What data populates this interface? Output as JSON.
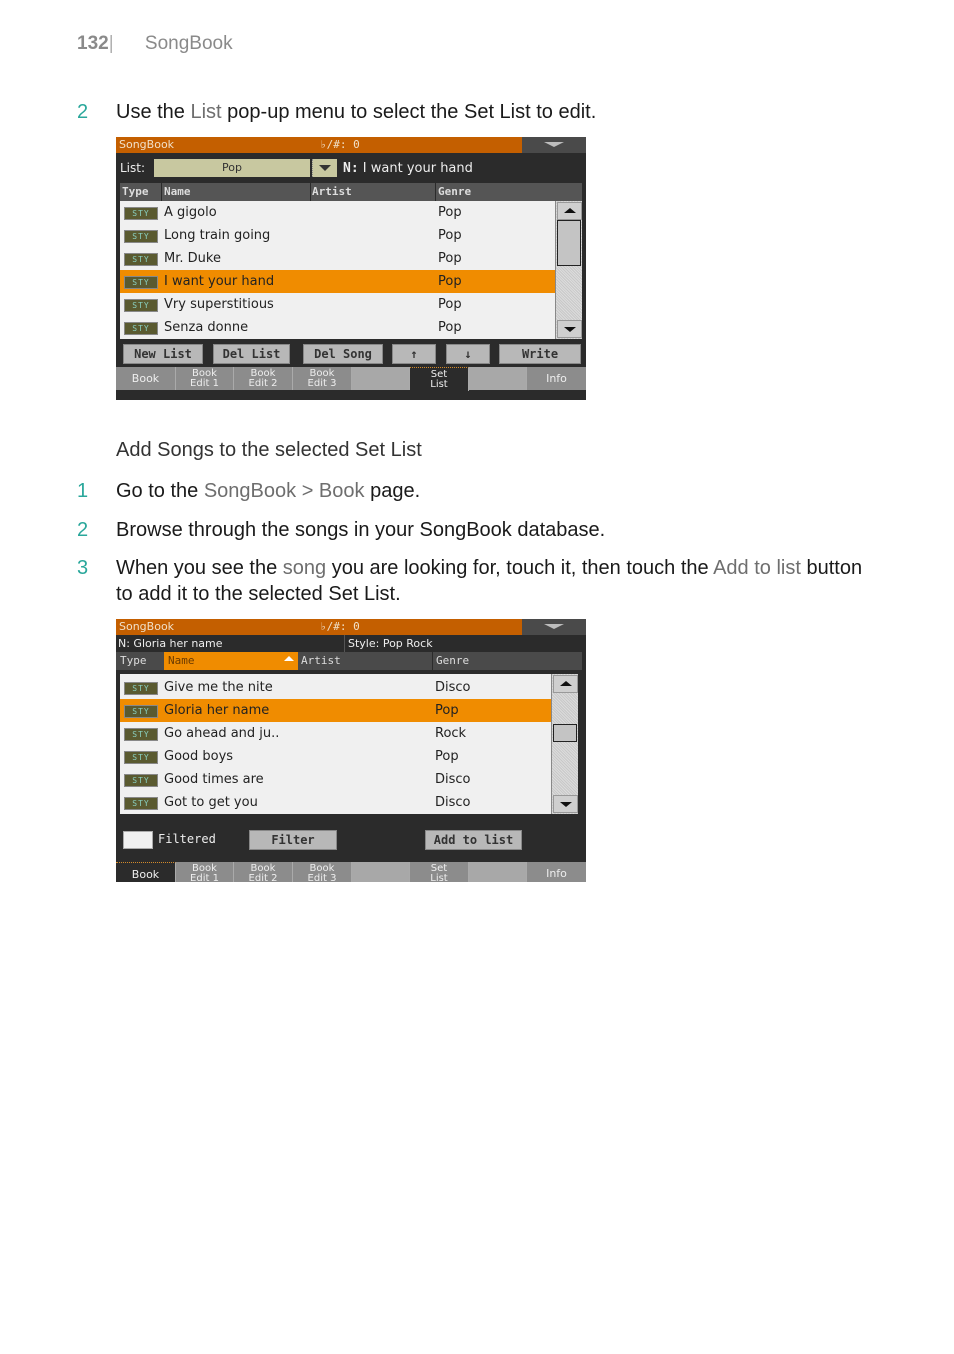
{
  "page": {
    "number": "132",
    "section": "SongBook"
  },
  "step_a": {
    "num": "2",
    "pre": "Use the ",
    "hl": "List",
    "post": " pop-up menu to select the Set List to edit."
  },
  "screen1": {
    "title": "SongBook",
    "key": "♭/#: 0",
    "list_label": "List:",
    "list_value": "Pop",
    "name_prefix": "N:",
    "name_value": "I want your hand",
    "columns": [
      "Type",
      "Name",
      "Artist",
      "Genre"
    ],
    "rows": [
      {
        "type": "STY",
        "name": "A gigolo",
        "artist": "",
        "genre": "Pop",
        "selected": false
      },
      {
        "type": "STY",
        "name": "Long train going",
        "artist": "",
        "genre": "Pop",
        "selected": false
      },
      {
        "type": "STY",
        "name": "Mr. Duke",
        "artist": "",
        "genre": "Pop",
        "selected": false
      },
      {
        "type": "STY",
        "name": "I want your hand",
        "artist": "",
        "genre": "Pop",
        "selected": true
      },
      {
        "type": "STY",
        "name": "Vry superstitious",
        "artist": "",
        "genre": "Pop",
        "selected": false
      },
      {
        "type": "STY",
        "name": "Senza donne",
        "artist": "",
        "genre": "Pop",
        "selected": false
      }
    ],
    "buttons": [
      "New List",
      "Del List",
      "Del Song",
      "↑",
      "↓",
      "Write"
    ],
    "tabs": [
      {
        "l1": "Book",
        "l2": ""
      },
      {
        "l1": "Book",
        "l2": "Edit 1"
      },
      {
        "l1": "Book",
        "l2": "Edit 2"
      },
      {
        "l1": "Book",
        "l2": "Edit 3"
      },
      {
        "l1": "",
        "l2": ""
      },
      {
        "l1": "Set",
        "l2": "List"
      },
      {
        "l1": "",
        "l2": ""
      },
      {
        "l1": "Info",
        "l2": ""
      }
    ],
    "active_tab": "Set List"
  },
  "subheading": "Add Songs to the selected Set List",
  "steps": [
    {
      "num": "1",
      "parts": [
        "Go to the ",
        "SongBook > Book",
        " page."
      ]
    },
    {
      "num": "2",
      "parts": [
        "Browse through the songs in your SongBook database."
      ]
    },
    {
      "num": "3",
      "parts": [
        "When you see the ",
        "song",
        " you are looking for, touch it, then touch the ",
        "Add to list",
        " button to add it to the selected Set List."
      ]
    }
  ],
  "screen2": {
    "title": "SongBook",
    "key": "♭/#: 0",
    "name_info": "N: Gloria her name",
    "style_info": "Style: Pop Rock",
    "columns": [
      "Type",
      "Name",
      "Artist",
      "Genre"
    ],
    "sorted_column": "Name",
    "rows": [
      {
        "type": "STY",
        "name": "Give me the nite",
        "genre": "Disco",
        "selected": false
      },
      {
        "type": "STY",
        "name": "Gloria her name",
        "genre": "Pop",
        "selected": true
      },
      {
        "type": "STY",
        "name": "Go ahead and ju..",
        "genre": "Rock",
        "selected": false
      },
      {
        "type": "STY",
        "name": "Good boys",
        "genre": "Pop",
        "selected": false
      },
      {
        "type": "STY",
        "name": "Good times are",
        "genre": "Disco",
        "selected": false
      },
      {
        "type": "STY",
        "name": "Got to get you",
        "genre": "Disco",
        "selected": false
      }
    ],
    "filtered_label": "Filtered",
    "filtered_checked": false,
    "filter_button": "Filter",
    "add_button": "Add to list",
    "active_tab": "Book"
  },
  "colors": {
    "accent_orange": "#f08c00",
    "title_orange": "#c45f00",
    "step_number": "#2aa79b"
  }
}
